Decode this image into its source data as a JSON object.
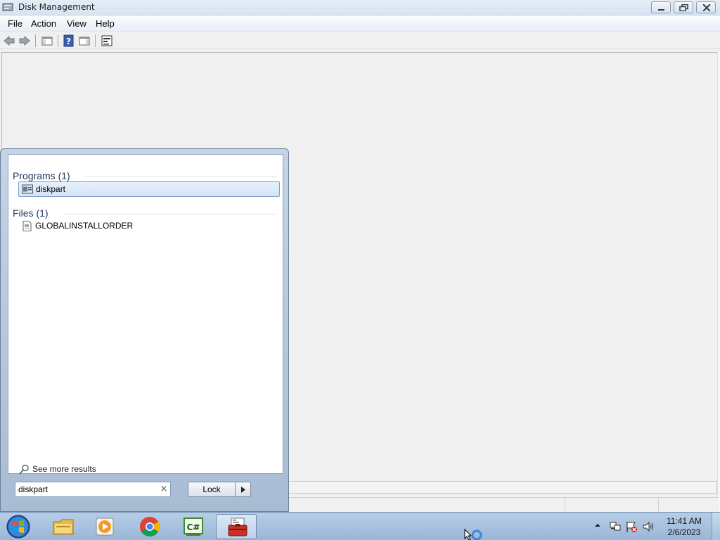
{
  "window": {
    "title": "Disk Management",
    "controls": {
      "minimize": "minimize",
      "restore": "restore",
      "close": "close"
    }
  },
  "menubar": {
    "items": [
      {
        "label": "File"
      },
      {
        "label": "Action"
      },
      {
        "label": "View"
      },
      {
        "label": "Help"
      }
    ]
  },
  "toolbar": {
    "icons": [
      "back-arrow-icon",
      "forward-arrow-icon",
      "show-hide-console-tree-icon",
      "help-icon",
      "show-hide-action-pane-icon",
      "properties-icon"
    ]
  },
  "start_menu": {
    "sections": [
      {
        "header": "Programs (1)",
        "items": [
          {
            "label": "diskpart",
            "selected": true,
            "icon": "program-icon"
          }
        ]
      },
      {
        "header": "Files (1)",
        "items": [
          {
            "label": "GLOBALINSTALLORDER",
            "selected": false,
            "icon": "file-icon"
          }
        ]
      }
    ],
    "see_more": "See more results",
    "search": {
      "value": "diskpart",
      "clear": "×"
    },
    "power_button": "Lock"
  },
  "taskbar": {
    "pinned": [
      "start-orb",
      "file-explorer-icon",
      "media-player-icon",
      "chrome-icon",
      "csharp-ide-icon",
      "toolbox-icon"
    ],
    "clock": {
      "time": "11:41 AM",
      "date": "2/6/2023"
    }
  },
  "colors": {
    "accent": "#1e395b",
    "selection": "#d3e4f7",
    "taskbar": "#9ab6d7"
  }
}
